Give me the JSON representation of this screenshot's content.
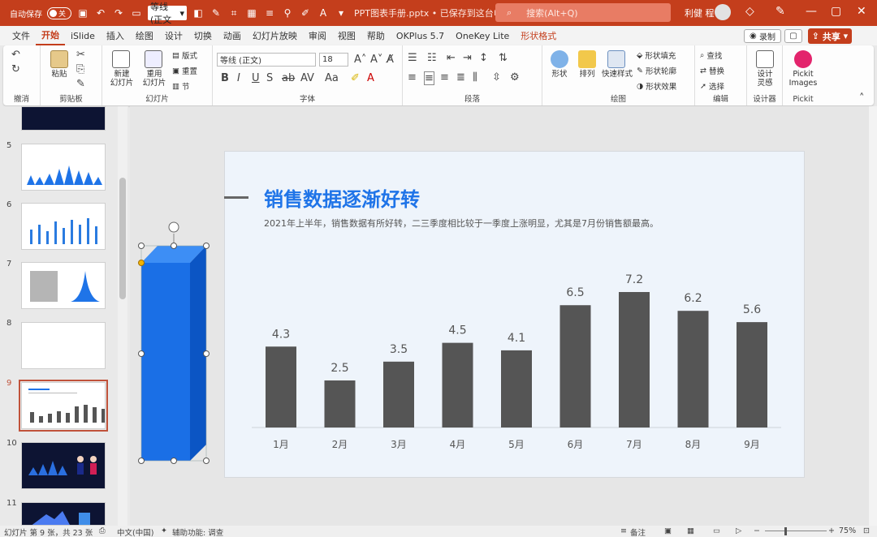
{
  "titlebar": {
    "autosave_label": "自动保存",
    "autosave_state": "关",
    "font_quick": "等线 (正文",
    "doc_title": "PPT图表手册.pptx • 已保存到这台电脑",
    "search_placeholder": "搜索(Alt+Q)",
    "user_name": "利健 程"
  },
  "tabs": [
    "文件",
    "开始",
    "iSlide",
    "插入",
    "绘图",
    "设计",
    "切换",
    "动画",
    "幻灯片放映",
    "审阅",
    "视图",
    "帮助",
    "OKPlus 5.7",
    "OneKey Lite",
    "形状格式"
  ],
  "active_tab": "开始",
  "actions": {
    "record": "录制",
    "share": "共享"
  },
  "ribbon": {
    "groups": [
      "撤消",
      "剪贴板",
      "幻灯片",
      "字体",
      "段落",
      "绘图",
      "编辑",
      "设计器",
      "Pickit"
    ],
    "paste": "粘贴",
    "new_slide": "新建\n幻灯片",
    "reuse_slide": "重用\n幻灯片",
    "layout": "版式",
    "reset": "重置",
    "section": "节",
    "font_name": "等线 (正文)",
    "font_size": "18",
    "shape": "形状",
    "arrange": "排列",
    "quick_styles": "快速样式",
    "shape_fill": "形状填充",
    "shape_outline": "形状轮廓",
    "shape_effects": "形状效果",
    "find": "查找",
    "replace": "替换",
    "select": "选择",
    "design_ideas": "设计\n灵感",
    "pickit": "Pickit\nImages"
  },
  "thumbnails": [
    {
      "num": "5"
    },
    {
      "num": "6"
    },
    {
      "num": "7"
    },
    {
      "num": "8"
    },
    {
      "num": "9"
    },
    {
      "num": "10"
    },
    {
      "num": "11"
    }
  ],
  "slide": {
    "title": "销售数据逐渐好转",
    "subtitle": "2021年上半年，销售数据有所好转，二三季度相比较于一季度上涨明显，尤其是7月份销售额最高。"
  },
  "chart_data": {
    "type": "bar",
    "categories": [
      "1月",
      "2月",
      "3月",
      "4月",
      "5月",
      "6月",
      "7月",
      "8月",
      "9月"
    ],
    "values": [
      4.3,
      2.5,
      3.5,
      4.5,
      4.1,
      6.5,
      7.2,
      6.2,
      5.6
    ],
    "bar_color": "#555555",
    "ylim": [
      0,
      7.2
    ]
  },
  "status": {
    "slide_info": "幻灯片 第 9 张，共 23 张",
    "language": "中文(中国)",
    "accessibility": "辅助功能: 调查",
    "notes": "备注",
    "zoom": "75%"
  },
  "colors": {
    "accent": "#c43e1c",
    "title_blue": "#1f74e8",
    "selected_bar": "#1a6fe6"
  }
}
